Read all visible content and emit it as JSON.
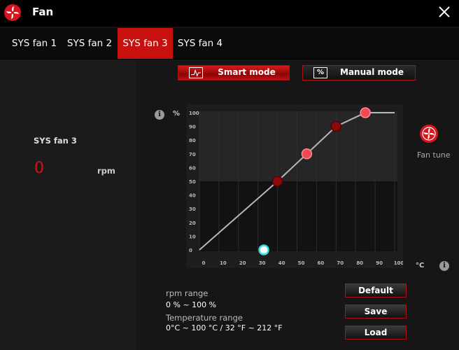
{
  "window": {
    "title": "Fan",
    "close_icon": "close-icon"
  },
  "tabs": [
    {
      "label": "SYS fan 1",
      "active": false
    },
    {
      "label": "SYS fan 2",
      "active": false
    },
    {
      "label": "SYS fan 3",
      "active": true
    },
    {
      "label": "SYS fan 4",
      "active": false
    }
  ],
  "left_panel": {
    "fan_name": "SYS fan 3",
    "rpm_value": "0",
    "rpm_unit": "rpm"
  },
  "modes": {
    "smart": {
      "label": "Smart mode",
      "icon": "curve-icon",
      "active": true
    },
    "manual": {
      "label": "Manual mode",
      "icon_text": "%",
      "active": false
    }
  },
  "fan_tune": {
    "label": "Fan tune"
  },
  "ranges": {
    "rpm_label": "rpm range",
    "rpm_value": "0 % ~ 100 %",
    "temp_label": "Temperature range",
    "temp_value": "0°C ~ 100 °C / 32 °F ~ 212 °F"
  },
  "buttons": {
    "default": "Default",
    "save": "Save",
    "load": "Load"
  },
  "colors": {
    "accent": "#c81010",
    "point_light": "#f04a55",
    "point_dark": "#8c0a0a",
    "current_marker": "#32e0e0"
  },
  "chart_data": {
    "type": "line",
    "xlabel": "°C",
    "ylabel": "%",
    "xlim": [
      0,
      100
    ],
    "ylim": [
      0,
      100
    ],
    "x_ticks": [
      0,
      10,
      20,
      30,
      40,
      50,
      60,
      70,
      80,
      90,
      100
    ],
    "y_ticks": [
      0,
      10,
      20,
      30,
      40,
      50,
      60,
      70,
      80,
      90,
      100
    ],
    "curve": [
      [
        0,
        0
      ],
      [
        40,
        50
      ],
      [
        55,
        70
      ],
      [
        70,
        90
      ],
      [
        85,
        100
      ],
      [
        100,
        100
      ]
    ],
    "control_points": [
      {
        "x": 40,
        "y": 50,
        "style": "dark"
      },
      {
        "x": 55,
        "y": 70,
        "style": "light"
      },
      {
        "x": 70,
        "y": 90,
        "style": "dark"
      },
      {
        "x": 85,
        "y": 100,
        "style": "light"
      }
    ],
    "current": {
      "x": 33,
      "y": 0
    },
    "threshold_y": 50,
    "info_icons": 2
  }
}
